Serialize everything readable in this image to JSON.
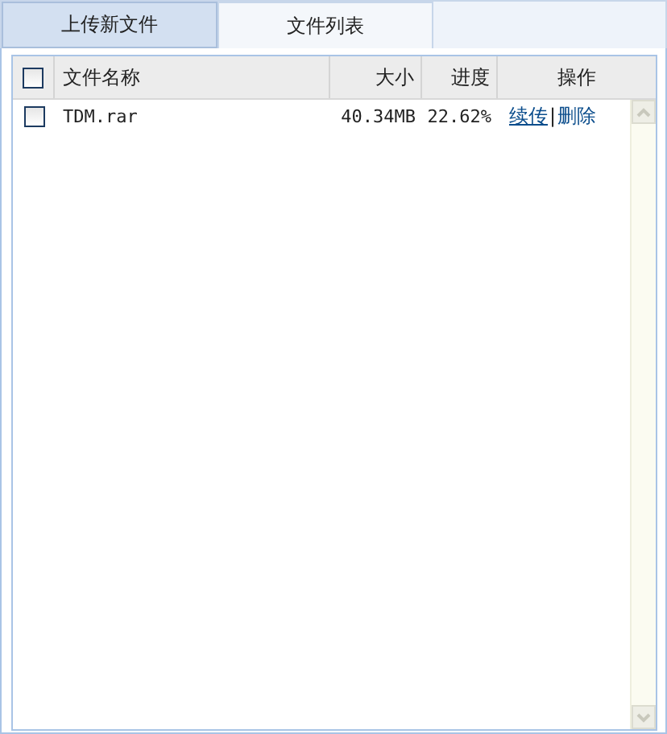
{
  "tabs": [
    {
      "label": "上传新文件",
      "selected": false
    },
    {
      "label": "文件列表",
      "selected": true
    }
  ],
  "table": {
    "select_all": {
      "checked": false
    },
    "columns": [
      "文件名称",
      "大小",
      "进度",
      "操作"
    ],
    "rows": [
      {
        "checked": false,
        "name": "TDM.rar",
        "size": "40.34MB",
        "progress": "22.62%",
        "actions": [
          "续传",
          "删除"
        ],
        "separator": "|"
      }
    ]
  }
}
